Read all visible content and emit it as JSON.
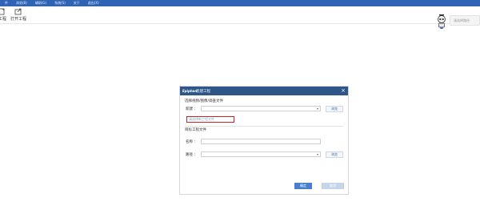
{
  "menubar": {
    "items": [
      {
        "label": "件"
      },
      {
        "label": "浏览(B)"
      },
      {
        "label": "辅助(G)"
      },
      {
        "label": "系统(S)"
      },
      {
        "label": "关于"
      },
      {
        "label": "退出(X)"
      }
    ]
  },
  "toolbar": {
    "new_label": "工程",
    "open_label": "打开工程"
  },
  "search": {
    "placeholder": "请选择路径"
  },
  "dialog": {
    "logo_text": "Epiphan",
    "title": "新建工程",
    "close_glyph": "×",
    "source_section_label": "选择视频/图像/调查文件",
    "new_field_label": "新建 ：",
    "browse_label": "浏览",
    "hint_placeholder": "请选择新工程文件",
    "target_section_label": "目标工程文件",
    "name_field_label": "名称 ：",
    "path_field_label": "路径 ：",
    "path_browse_label": "浏览",
    "dropdown_glyph": "▾"
  },
  "footer": {
    "ok_label": "确定",
    "cancel_label": "取消"
  },
  "colors": {
    "menubar": "#2f63b3",
    "dialog_title": "#2e5688",
    "highlight_border": "#cc2222",
    "ok_button": "#4a7fd0",
    "cancel_button": "#c6d4ea"
  }
}
